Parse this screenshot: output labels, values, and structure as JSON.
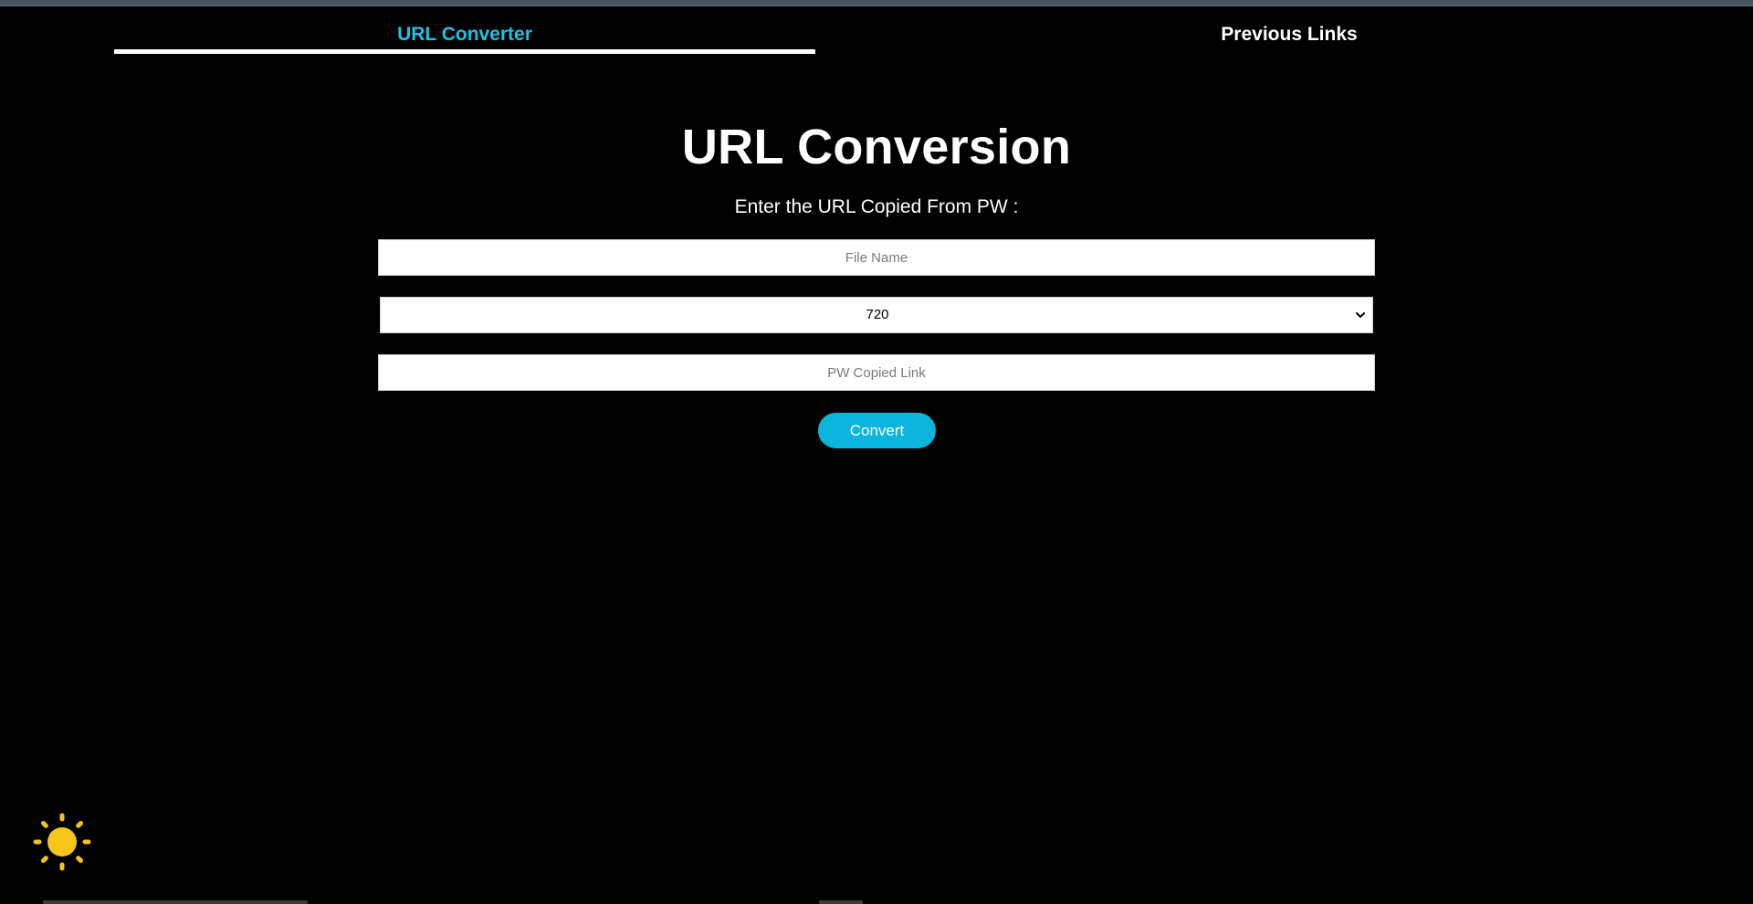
{
  "tabs": [
    {
      "label": "URL Converter",
      "active": true
    },
    {
      "label": "Previous Links",
      "active": false
    }
  ],
  "main": {
    "title": "URL Conversion",
    "subtitle": "Enter the URL Copied From PW :",
    "file_name_placeholder": "File Name",
    "quality_selected": "720",
    "link_placeholder": "PW Copied Link",
    "convert_label": "Convert"
  },
  "theme_toggle": {
    "icon": "sun-icon"
  },
  "colors": {
    "background": "#000000",
    "accent": "#0ab6dd",
    "active_tab": "#1ec0e6",
    "sun": "#f5c518"
  }
}
